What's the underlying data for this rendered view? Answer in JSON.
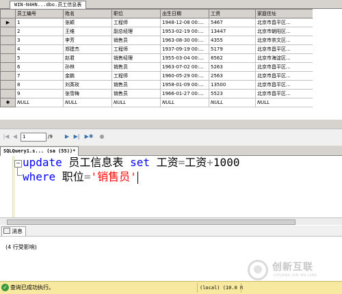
{
  "top_tab": {
    "label": "WIN-N4HN...dbo.员工信息表"
  },
  "grid": {
    "columns": [
      "员工编号",
      "姓名",
      "职位",
      "出生日期",
      "工资",
      "家庭住址"
    ],
    "rows": [
      [
        "1",
        "张颖",
        "工程师",
        "1948-12-08 00:...",
        "5467",
        "北京市昌平区..."
      ],
      [
        "2",
        "王维",
        "副总经理",
        "1953-02-19 00:...",
        "13447",
        "北京市朝阳区..."
      ],
      [
        "3",
        "李芳",
        "销售员",
        "1963-08-30 00:...",
        "4355",
        "北京市崇文区..."
      ],
      [
        "4",
        "郑建杰",
        "工程师",
        "1937-09-19 00:...",
        "5179",
        "北京市昌平区..."
      ],
      [
        "5",
        "赵君",
        "销售经理",
        "1955-03-04 00:...",
        "8562",
        "北京市海淀区..."
      ],
      [
        "6",
        "孙林",
        "销售员",
        "1963-07-02 00:...",
        "5263",
        "北京市昌平区..."
      ],
      [
        "7",
        "金鹏",
        "工程师",
        "1960-05-29 00:...",
        "2563",
        "北京市昌平区..."
      ],
      [
        "8",
        "刘英玫",
        "销售员",
        "1958-01-09 00:...",
        "13500",
        "北京市昌平区..."
      ],
      [
        "9",
        "张雪梅",
        "销售员",
        "1966-01-27 00:...",
        "5523",
        "北京市昌平区..."
      ]
    ],
    "new_row": [
      "NULL",
      "NULL",
      "NULL",
      "NULL",
      "NULL",
      "NULL"
    ],
    "current_row_marker": "▶",
    "new_row_marker": "✱"
  },
  "navigator": {
    "first": "|◀",
    "prev": "◀",
    "current": "1",
    "of": "/9",
    "next": "▶",
    "last": "▶|",
    "new": "▶✱",
    "stop": "●"
  },
  "editor_tab": {
    "label": "SQLQuery1.s... (sa (55))*"
  },
  "editor": {
    "line1": {
      "kw1": "update",
      "t1": " 员工信息表 ",
      "kw2": "set",
      "t2": " 工资",
      "op1": "=",
      "t3": "工资",
      "op2": "+",
      "t4": "1000"
    },
    "line2": {
      "kw1": "where",
      "t1": " 职位",
      "op1": "=",
      "str1": "'销售员'"
    }
  },
  "messages": {
    "tab_label": "消息",
    "text": "(4 行受影响)"
  },
  "status": {
    "text": "查询已成功执行。",
    "server": "(local) (10.0 R"
  },
  "watermark": {
    "cn": "创新互联",
    "en": "CHUANG XIN HU LIAN"
  }
}
